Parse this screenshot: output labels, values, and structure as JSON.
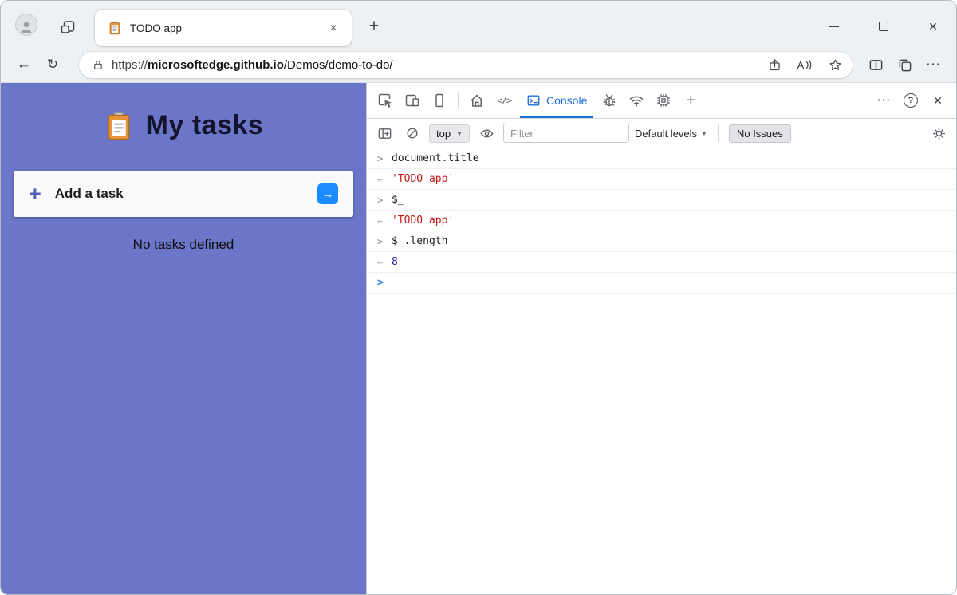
{
  "browser": {
    "tab_title": "TODO app",
    "url": {
      "scheme": "https://",
      "host": "microsoftedge.github.io",
      "path": "/Demos/demo-to-do/"
    }
  },
  "icons": {
    "back": "←",
    "refresh": "↻",
    "new_tab": "+",
    "close_x": "✕",
    "more": "⋯",
    "help": "?",
    "plus_tool": "+",
    "code": "</>",
    "caret_down": "▼",
    "read_aloud_letter": "A"
  },
  "todo": {
    "title": "My tasks",
    "plus": "+",
    "add_task": "Add a task",
    "go_arrow": "→",
    "empty": "No tasks defined"
  },
  "devtools": {
    "console_tab": "Console",
    "console_toolbar": {
      "context": "top",
      "filter_placeholder": "Filter",
      "levels": "Default levels",
      "issues": "No Issues"
    },
    "markers": {
      "input": ">",
      "result": "←",
      "prompt": ">"
    },
    "entries": [
      {
        "kind": "input",
        "text": "document.title"
      },
      {
        "kind": "result",
        "text": "'TODO app'"
      },
      {
        "kind": "input",
        "text": "$_"
      },
      {
        "kind": "result",
        "text": "'TODO app'"
      },
      {
        "kind": "input",
        "text": "$_.length"
      },
      {
        "kind": "result",
        "text": "8"
      },
      {
        "kind": "prompt",
        "text": ""
      }
    ]
  },
  "colors": {
    "todo_panel_purple": "#6b76c8",
    "devtools_accent_blue": "#1b6fd6",
    "add_button_blue": "#1a8cff",
    "console_string_red": "#c41a16",
    "console_number_blue": "#1a1aa6"
  }
}
